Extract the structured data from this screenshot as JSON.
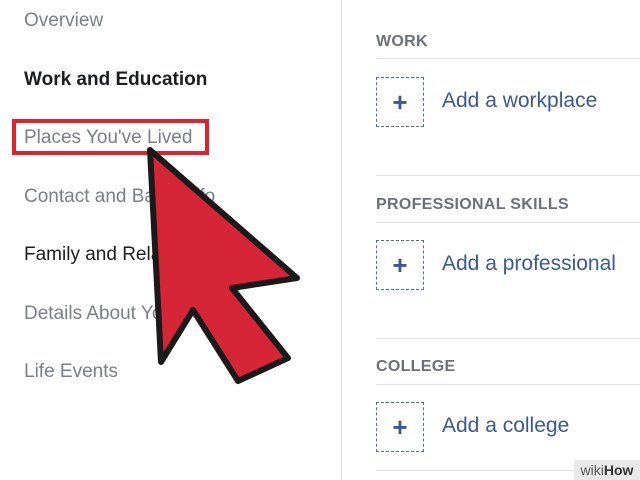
{
  "sidebar": {
    "items": [
      {
        "label": "Overview"
      },
      {
        "label": "Work and Education"
      },
      {
        "label": "Places You've Lived"
      },
      {
        "label": "Contact and Basic Info"
      },
      {
        "label": "Family and Relationships"
      },
      {
        "label": "Details About You"
      },
      {
        "label": "Life Events"
      }
    ]
  },
  "main": {
    "sections": [
      {
        "heading": "WORK",
        "add_label": "Add a workplace"
      },
      {
        "heading": "PROFESSIONAL SKILLS",
        "add_label": "Add a professional"
      },
      {
        "heading": "COLLEGE",
        "add_label": "Add a college"
      }
    ],
    "plus_symbol": "+"
  },
  "watermark": {
    "prefix": "wiki",
    "suffix": "How"
  },
  "colors": {
    "highlight": "#e3202d",
    "arrow": "#d62536",
    "link": "#3b5998"
  }
}
